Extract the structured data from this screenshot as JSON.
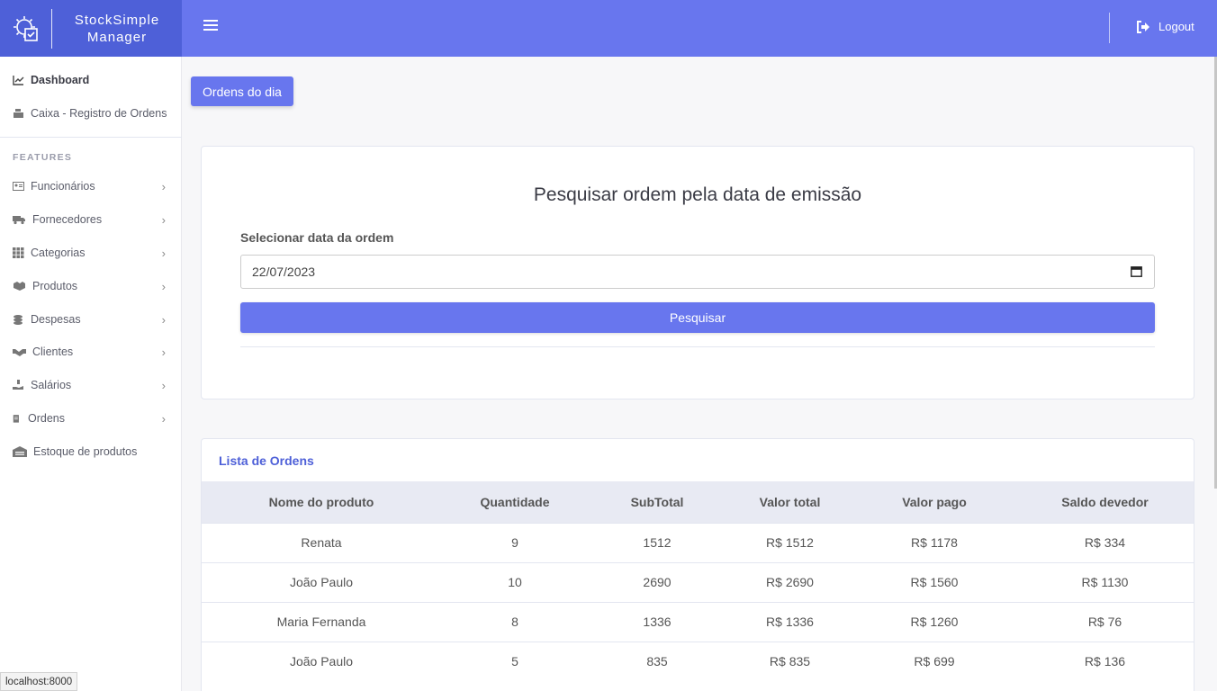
{
  "brand": {
    "line1": "StockSimple",
    "line2": "Manager",
    "logo_icon": "gear-checklist-icon"
  },
  "topbar": {
    "menu_icon": "hamburger-icon",
    "logout_label": "Logout",
    "logout_icon": "sign-out-icon"
  },
  "sidebar": {
    "top_items": [
      {
        "label": "Dashboard",
        "icon": "chart-line-icon"
      },
      {
        "label": "Caixa - Registro de Ordens",
        "icon": "cash-register-icon"
      }
    ],
    "heading": "FEATURES",
    "feature_items": [
      {
        "label": "Funcionários",
        "icon": "id-card-icon"
      },
      {
        "label": "Fornecedores",
        "icon": "truck-icon"
      },
      {
        "label": "Categorias",
        "icon": "grid-icon"
      },
      {
        "label": "Produtos",
        "icon": "boxes-icon"
      },
      {
        "label": "Despesas",
        "icon": "coins-icon"
      },
      {
        "label": "Clientes",
        "icon": "handshake-icon"
      },
      {
        "label": "Salários",
        "icon": "hand-money-icon"
      },
      {
        "label": "Ordens",
        "icon": "clipboard-icon"
      },
      {
        "label": "Estoque de produtos",
        "icon": "warehouse-icon"
      }
    ]
  },
  "main": {
    "ordens_button": "Ordens do dia",
    "search": {
      "title": "Pesquisar ordem pela data de emissão",
      "date_label": "Selecionar data da ordem",
      "date_value": "22/07/2023",
      "button": "Pesquisar"
    },
    "list": {
      "title": "Lista de Ordens",
      "headers": [
        "Nome do produto",
        "Quantidade",
        "SubTotal",
        "Valor total",
        "Valor pago",
        "Saldo devedor"
      ],
      "rows": [
        [
          "Renata",
          "9",
          "1512",
          "R$ 1512",
          "R$ 1178",
          "R$ 334"
        ],
        [
          "João Paulo",
          "10",
          "2690",
          "R$ 2690",
          "R$ 1560",
          "R$ 1130"
        ],
        [
          "Maria Fernanda",
          "8",
          "1336",
          "R$ 1336",
          "R$ 1260",
          "R$ 76"
        ],
        [
          "João Paulo",
          "5",
          "835",
          "R$ 835",
          "R$ 699",
          "R$ 136"
        ]
      ]
    }
  },
  "status_url": "localhost:8000",
  "colors": {
    "brand": "#4e60d8",
    "primary": "#6876ee"
  }
}
